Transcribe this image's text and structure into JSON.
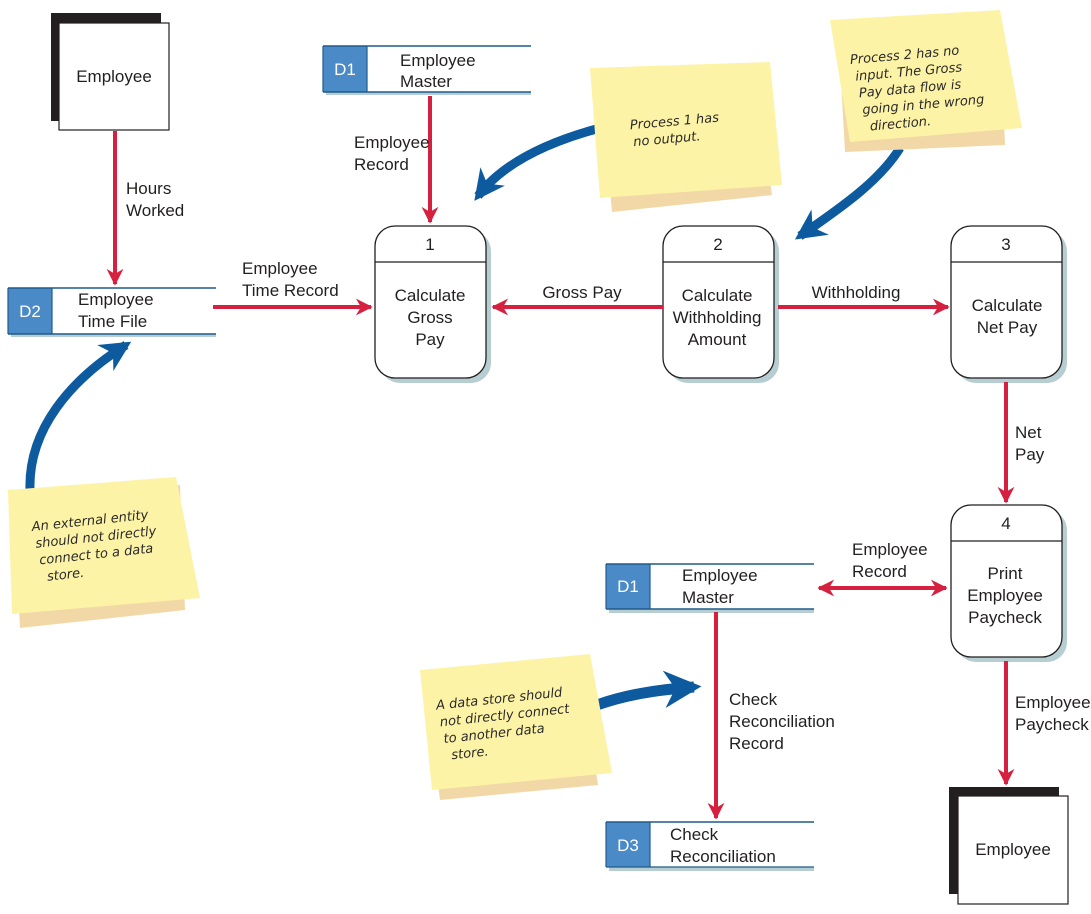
{
  "colors": {
    "flow": "#d5203f",
    "callout_arrow": "#0d5a9e",
    "datastore_id_bg": "#4a8ac6",
    "datastore_line": "#1f5b8c",
    "note_bg": "#fdf3a6",
    "note_shadow": "#f1d8a6",
    "process_shadow": "#b6cdd1"
  },
  "entities": {
    "employee_source": "Employee",
    "employee_sink": "Employee"
  },
  "datastores": {
    "d1_top": {
      "id": "D1",
      "line1": "Employee",
      "line2": "Master"
    },
    "d2": {
      "id": "D2",
      "line1": "Employee",
      "line2": "Time File"
    },
    "d1_bottom": {
      "id": "D1",
      "line1": "Employee",
      "line2": "Master"
    },
    "d3": {
      "id": "D3",
      "line1": "Check",
      "line2": "Reconciliation"
    }
  },
  "processes": {
    "p1": {
      "number": "1",
      "lines": [
        "Calculate",
        "Gross",
        "Pay"
      ]
    },
    "p2": {
      "number": "2",
      "lines": [
        "Calculate",
        "Withholding",
        "Amount"
      ]
    },
    "p3": {
      "number": "3",
      "lines": [
        "Calculate",
        "Net Pay"
      ]
    },
    "p4": {
      "number": "4",
      "lines": [
        "Print",
        "Employee",
        "Paycheck"
      ]
    }
  },
  "flows": {
    "hours_worked": [
      "Hours",
      "Worked"
    ],
    "employee_record_top": [
      "Employee",
      "Record"
    ],
    "employee_time_record": [
      "Employee",
      "Time Record"
    ],
    "gross_pay": [
      "Gross Pay"
    ],
    "withholding": [
      "Withholding"
    ],
    "net_pay": [
      "Net",
      "Pay"
    ],
    "employee_record_bottom": [
      "Employee",
      "Record"
    ],
    "check_reconciliation_record": [
      "Check",
      "Reconciliation",
      "Record"
    ],
    "employee_paycheck": [
      "Employee",
      "Paycheck"
    ]
  },
  "notes": {
    "process1": [
      "Process 1 has",
      "no output."
    ],
    "process2": [
      "Process 2 has no",
      "input. The Gross",
      "Pay data flow is",
      "going in the wrong",
      "direction."
    ],
    "entity_store": [
      "An external entity",
      "should not directly",
      "connect to a data",
      "store."
    ],
    "store_store": [
      "A data store should",
      "not directly connect",
      "to another data",
      "store."
    ]
  }
}
